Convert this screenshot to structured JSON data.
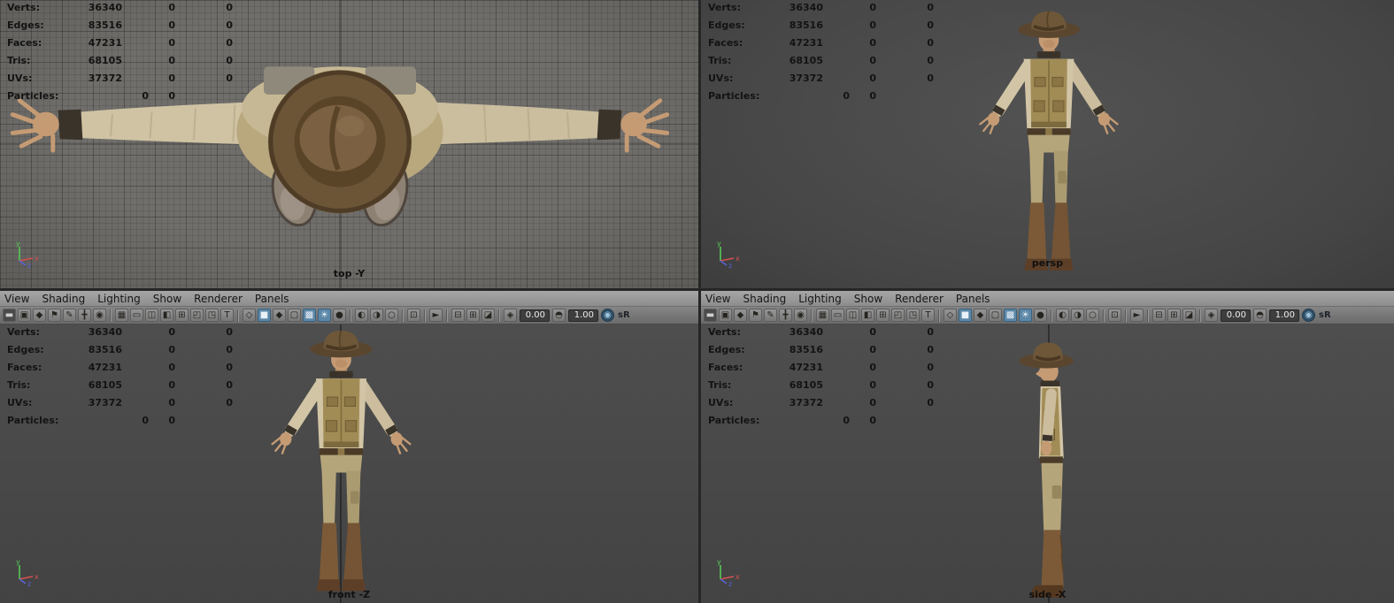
{
  "hud": {
    "rows": [
      {
        "label": "Verts:",
        "col1": "36340",
        "col2": "0",
        "col3": "0"
      },
      {
        "label": "Edges:",
        "col1": "83516",
        "col2": "0",
        "col3": "0"
      },
      {
        "label": "Faces:",
        "col1": "47231",
        "col2": "0",
        "col3": "0"
      },
      {
        "label": "Tris:",
        "col1": "68105",
        "col2": "0",
        "col3": "0"
      },
      {
        "label": "UVs:",
        "col1": "37372",
        "col2": "0",
        "col3": "0"
      },
      {
        "label": "Particles:",
        "col1": "0",
        "col2": "0"
      }
    ]
  },
  "menu": {
    "items": [
      {
        "label": "View"
      },
      {
        "label": "Shading"
      },
      {
        "label": "Lighting"
      },
      {
        "label": "Show"
      },
      {
        "label": "Renderer"
      },
      {
        "label": "Panels"
      }
    ]
  },
  "toolbar": {
    "exposure_value": "0.00",
    "gamma_value": "1.00",
    "color_space_label": "sR",
    "icons": [
      {
        "name": "panel-menu-icon",
        "glyph": "▬"
      },
      {
        "name": "select-camera-icon",
        "glyph": "▣"
      },
      {
        "name": "lock-camera-icon",
        "glyph": "◆"
      },
      {
        "name": "bookmark-icon",
        "glyph": "⚑"
      },
      {
        "name": "grease-pencil-icon",
        "glyph": "✎"
      },
      {
        "name": "pan-zoom-icon",
        "glyph": "╋"
      },
      {
        "name": "image-plane-icon",
        "glyph": "◉"
      },
      {
        "name": "grid-icon",
        "glyph": "▦"
      },
      {
        "name": "film-gate-icon",
        "glyph": "▭"
      },
      {
        "name": "resolution-gate-icon",
        "glyph": "◫"
      },
      {
        "name": "gate-mask-icon",
        "glyph": "◧"
      },
      {
        "name": "field-chart-icon",
        "glyph": "⊞"
      },
      {
        "name": "safe-action-icon",
        "glyph": "◰"
      },
      {
        "name": "safe-title-icon",
        "glyph": "◳"
      },
      {
        "name": "hud-toggle-icon",
        "glyph": "T"
      },
      {
        "name": "wireframe-icon",
        "glyph": "◇"
      },
      {
        "name": "smooth-shade-icon",
        "glyph": "■"
      },
      {
        "name": "flat-shade-icon",
        "glyph": "◆"
      },
      {
        "name": "bounding-box-icon",
        "glyph": "▢"
      },
      {
        "name": "textured-icon",
        "glyph": "▩"
      },
      {
        "name": "lights-icon",
        "glyph": "☀"
      },
      {
        "name": "shadows-icon",
        "glyph": "●"
      },
      {
        "name": "ao-icon",
        "glyph": "◐"
      },
      {
        "name": "motion-blur-icon",
        "glyph": "◑"
      },
      {
        "name": "multisample-icon",
        "glyph": "○"
      },
      {
        "name": "isolate-select-icon",
        "glyph": "⊡"
      },
      {
        "name": "select-tool-icon",
        "glyph": "►"
      },
      {
        "name": "single-pane-icon",
        "glyph": "⊟"
      },
      {
        "name": "tear-off-copy-icon",
        "glyph": "⊞"
      },
      {
        "name": "outliner-pane-icon",
        "glyph": "◪"
      },
      {
        "name": "exposure-icon",
        "glyph": "◈"
      },
      {
        "name": "gamma-toggle-icon",
        "glyph": "◓"
      },
      {
        "name": "color-management-icon",
        "glyph": "◉"
      }
    ]
  },
  "viewports": {
    "top": {
      "label": "top -Y"
    },
    "persp": {
      "label": "persp"
    },
    "front": {
      "label": "front -Z"
    },
    "side": {
      "label": "side -X"
    }
  },
  "axis": {
    "x": "x",
    "y": "y",
    "z": "z"
  },
  "colors": {
    "viewport_bg": "#4a4a4a",
    "grid_bg": "#6f6e6b",
    "active_icon": "#5d87a6",
    "axis_x": "#d65050",
    "axis_y": "#57c957",
    "axis_z": "#5863d6",
    "hud_text": "#131313"
  }
}
